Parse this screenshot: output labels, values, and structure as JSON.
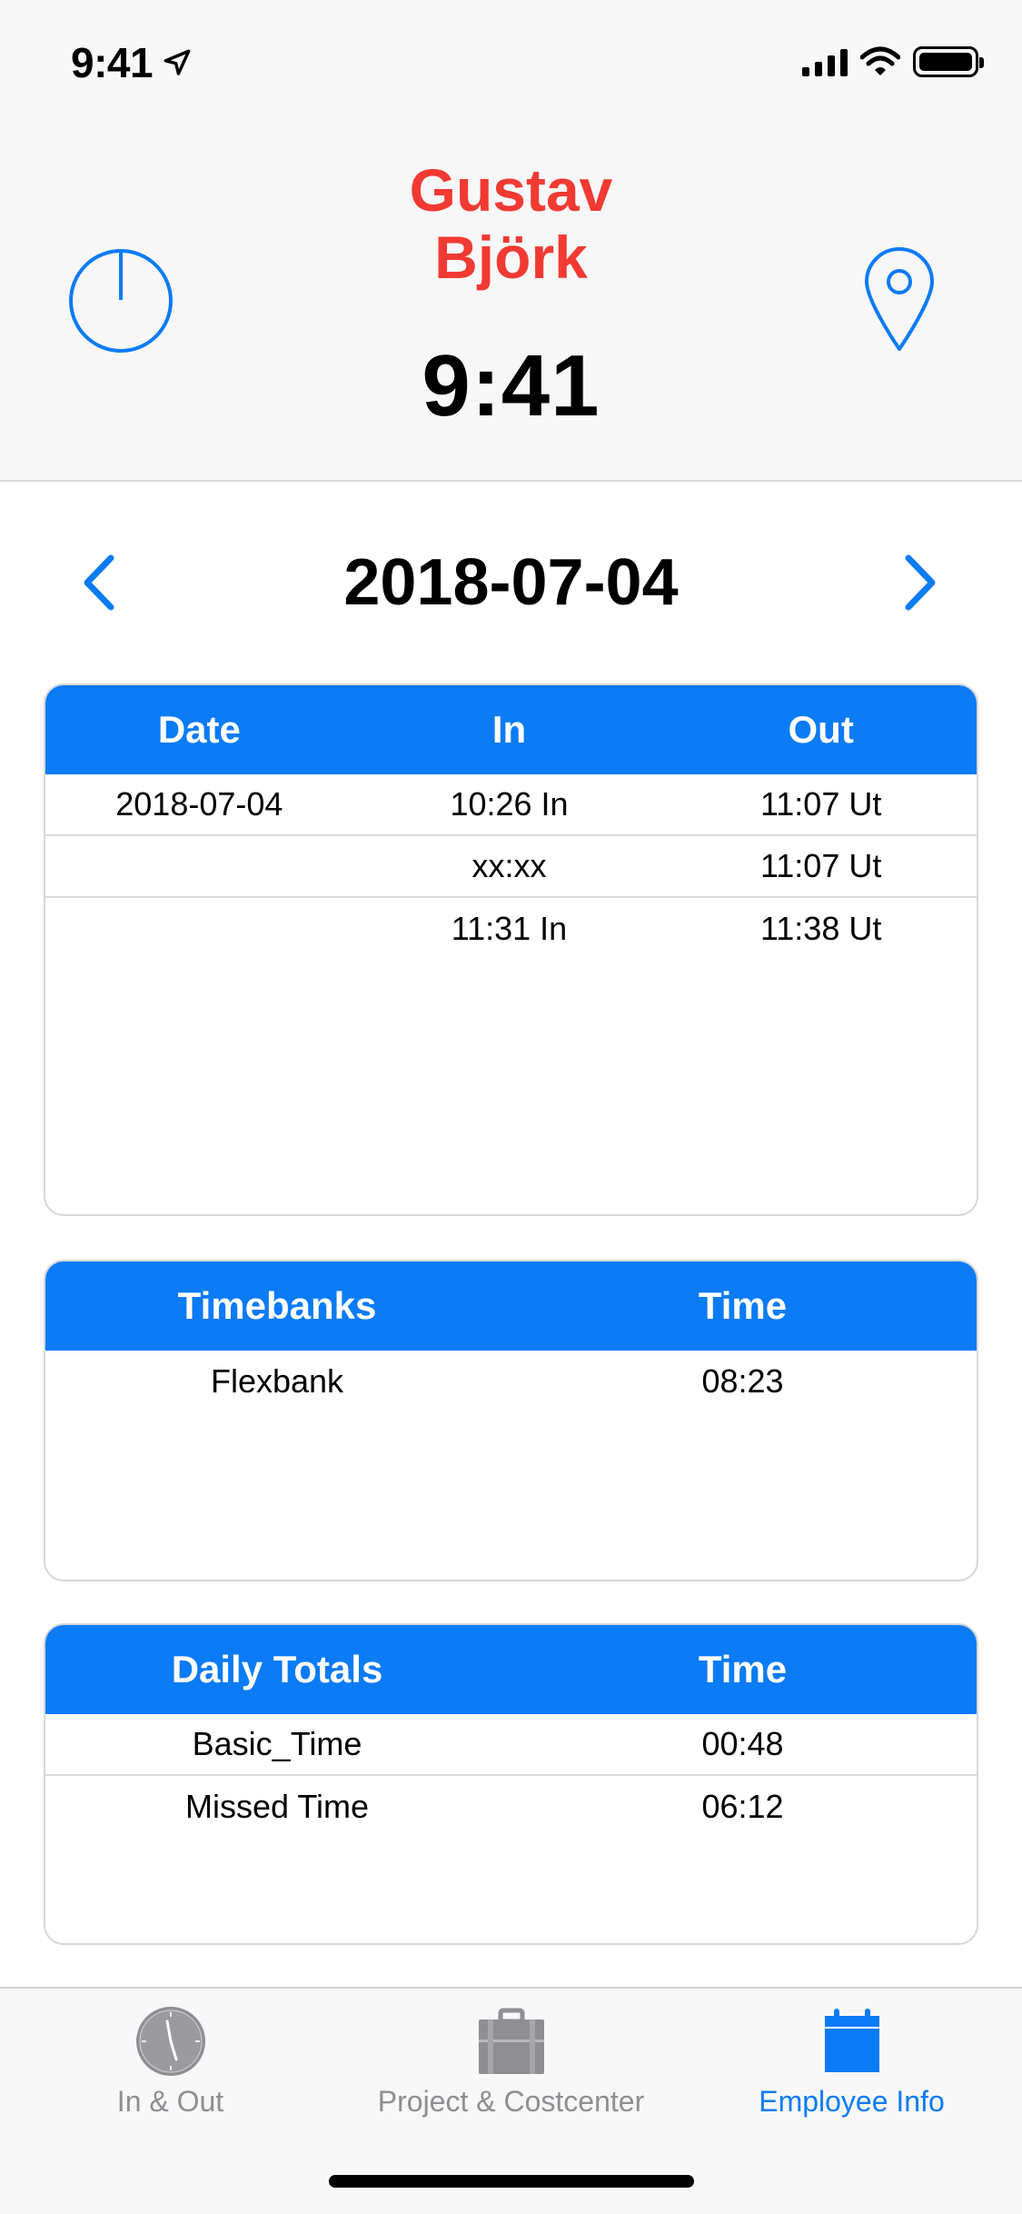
{
  "status_bar": {
    "time": "9:41"
  },
  "header": {
    "user_name_first": "Gustav",
    "user_name_last": "Björk",
    "current_time": "9:41",
    "power_icon": "power-icon",
    "location_icon": "location-pin-icon"
  },
  "date_nav": {
    "date": "2018-07-04",
    "prev_icon": "chevron-left-icon",
    "next_icon": "chevron-right-icon"
  },
  "times_table": {
    "headers": [
      "Date",
      "In",
      "Out"
    ],
    "rows": [
      [
        "2018-07-04",
        "10:26 In",
        "11:07 Ut"
      ],
      [
        "",
        "xx:xx",
        "11:07 Ut"
      ],
      [
        "",
        "11:31 In",
        "11:38 Ut"
      ]
    ]
  },
  "timebanks_table": {
    "headers": [
      "Timebanks",
      "Time"
    ],
    "rows": [
      [
        "Flexbank",
        "08:23"
      ]
    ]
  },
  "totals_table": {
    "headers": [
      "Daily Totals",
      "Time"
    ],
    "rows": [
      [
        "Basic_Time",
        "00:48"
      ],
      [
        "Missed Time",
        "06:12"
      ]
    ]
  },
  "tabbar": {
    "tabs": [
      {
        "label": "In & Out",
        "icon": "clock-icon",
        "active": false
      },
      {
        "label": "Project & Costcenter",
        "icon": "briefcase-icon",
        "active": false
      },
      {
        "label": "Employee Info",
        "icon": "calendar-icon",
        "active": true
      }
    ]
  },
  "colors": {
    "accent": "#0b7bf6",
    "name": "#f13a32",
    "inactive": "#8e8e93"
  }
}
